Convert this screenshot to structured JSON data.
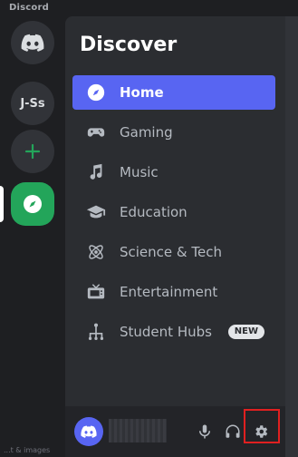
{
  "window": {
    "title": "Discord"
  },
  "servers": [
    {
      "type": "home",
      "icon": "discord-logo-icon"
    },
    {
      "type": "server",
      "label": "J-Ss"
    },
    {
      "type": "add",
      "icon": "plus-icon"
    },
    {
      "type": "explore",
      "icon": "compass-icon"
    }
  ],
  "sidebar": {
    "title": "Discover",
    "items": [
      {
        "label": "Home",
        "icon": "compass-icon",
        "selected": true
      },
      {
        "label": "Gaming",
        "icon": "controller-icon"
      },
      {
        "label": "Music",
        "icon": "music-note-icon"
      },
      {
        "label": "Education",
        "icon": "graduation-cap-icon"
      },
      {
        "label": "Science & Tech",
        "icon": "atom-icon"
      },
      {
        "label": "Entertainment",
        "icon": "tv-icon"
      },
      {
        "label": "Student Hubs",
        "icon": "hub-icon",
        "badge": "NEW"
      }
    ]
  },
  "user_panel": {
    "controls": [
      "microphone-icon",
      "headphones-icon",
      "gear-icon"
    ]
  },
  "bottom_hint": "...t & images",
  "colors": {
    "accent": "#5865f2",
    "green": "#23a55a",
    "highlight": "#e02020"
  }
}
